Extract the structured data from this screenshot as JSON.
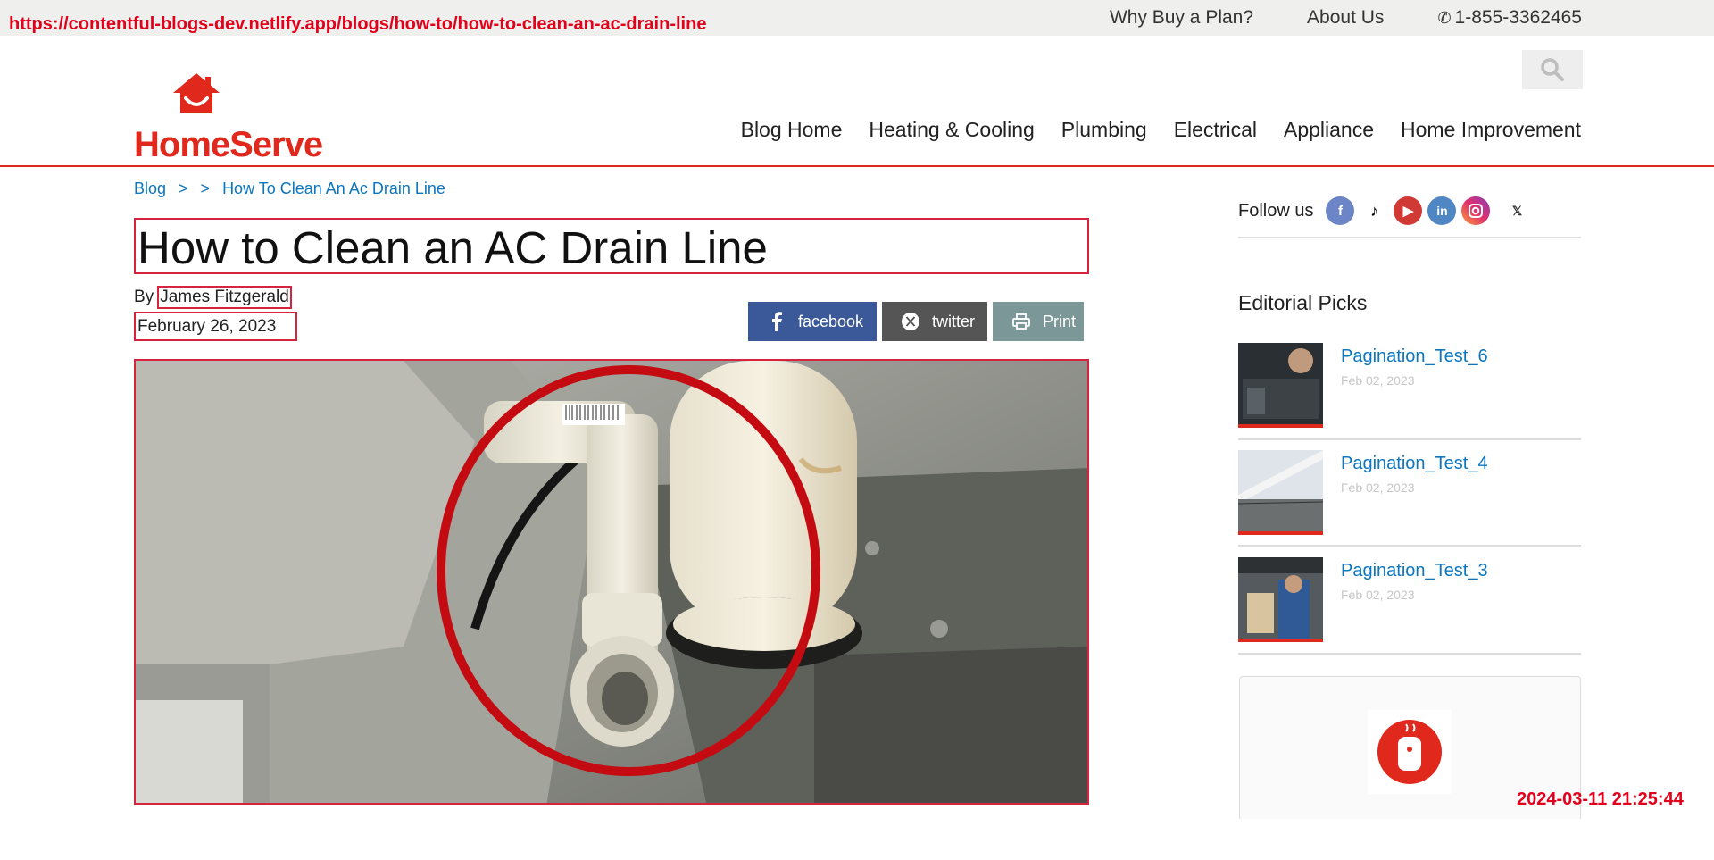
{
  "overlay": {
    "url": "https://contentful-blogs-dev.netlify.app/blogs/how-to/how-to-clean-an-ac-drain-line",
    "timestamp": "2024-03-11 21:25:44"
  },
  "topbar": {
    "links": [
      "Why Buy a Plan?",
      "About Us"
    ],
    "phone": "1-855-3362465"
  },
  "brand": {
    "name": "HomeServe",
    "color": "#e0291c"
  },
  "nav": {
    "items": [
      "Blog Home",
      "Heating & Cooling",
      "Plumbing",
      "Electrical",
      "Appliance",
      "Home Improvement"
    ]
  },
  "breadcrumb": {
    "root": "Blog",
    "sep1": ">",
    "sep2": ">",
    "current": "How To Clean An Ac Drain Line"
  },
  "article": {
    "title": "How to Clean an AC Drain Line",
    "by_label": "By",
    "author": "James Fitzgerald",
    "date": "February 26, 2023"
  },
  "share": {
    "facebook": "facebook",
    "twitter": "twitter",
    "print": "Print"
  },
  "sidebar": {
    "follow_label": "Follow us",
    "social_icons": [
      "facebook-icon",
      "tiktok-icon",
      "youtube-icon",
      "linkedin-icon",
      "instagram-icon",
      "x-icon"
    ],
    "picks_title": "Editorial Picks",
    "picks": [
      {
        "title": "Pagination_Test_6",
        "date": "Feb 02, 2023"
      },
      {
        "title": "Pagination_Test_4",
        "date": "Feb 02, 2023"
      },
      {
        "title": "Pagination_Test_3",
        "date": "Feb 02, 2023"
      }
    ]
  },
  "colors": {
    "link": "#0c76be",
    "accent_red": "#e0291c",
    "facebook": "#3b5998",
    "twitter": "#555555",
    "print": "#7b9798"
  }
}
